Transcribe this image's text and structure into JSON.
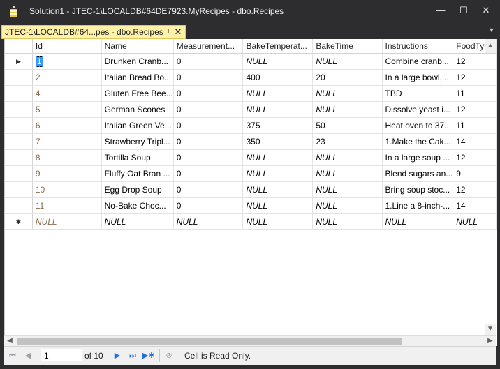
{
  "window": {
    "title": "Solution1 - JTEC-1\\LOCALDB#64DE7923.MyRecipes - dbo.Recipes",
    "minimize_glyph": "—",
    "maximize_glyph": "☐",
    "close_glyph": "✕"
  },
  "tab": {
    "label": "JTEC-1\\LOCALDB#64...pes - dbo.Recipes",
    "pin_glyph": "⊣",
    "close_glyph": "✕",
    "active_color": "#fff1a8"
  },
  "grid": {
    "columns": [
      "Id",
      "Name",
      "Measurement...",
      "BakeTemperat...",
      "BakeTime",
      "Instructions",
      "FoodTypeI"
    ],
    "rows": [
      {
        "marker": "▶",
        "cells": [
          "1",
          "Drunken Cranb...",
          "0",
          "NULL",
          "NULL",
          "Combine cranb...",
          "12"
        ]
      },
      {
        "marker": "",
        "cells": [
          "2",
          "Italian Bread Bo...",
          "0",
          "400",
          "20",
          "In a large bowl, ...",
          "12"
        ]
      },
      {
        "marker": "",
        "cells": [
          "4",
          "Gluten Free Bee...",
          "0",
          "NULL",
          "NULL",
          "TBD",
          "11"
        ]
      },
      {
        "marker": "",
        "cells": [
          "5",
          "German Scones",
          "0",
          "NULL",
          "NULL",
          "Dissolve yeast i...",
          "12"
        ]
      },
      {
        "marker": "",
        "cells": [
          "6",
          "Italian Green Ve...",
          "0",
          "375",
          "50",
          "Heat oven to 37...",
          "11"
        ]
      },
      {
        "marker": "",
        "cells": [
          "7",
          "Strawberry Tripl...",
          "0",
          "350",
          "23",
          "1.Make the Cak...",
          "14"
        ]
      },
      {
        "marker": "",
        "cells": [
          "8",
          "Tortilla Soup",
          "0",
          "NULL",
          "NULL",
          "In a large soup ...",
          "12"
        ]
      },
      {
        "marker": "",
        "cells": [
          "9",
          "Fluffy Oat Bran ...",
          "0",
          "NULL",
          "NULL",
          "Blend sugars an...",
          "9"
        ]
      },
      {
        "marker": "",
        "cells": [
          "10",
          "Egg Drop Soup",
          "0",
          "NULL",
          "NULL",
          "Bring soup stoc...",
          "12"
        ]
      },
      {
        "marker": "",
        "cells": [
          "11",
          "No-Bake Choc...",
          "0",
          "NULL",
          "NULL",
          "1.Line a 8-inch-...",
          "14"
        ]
      },
      {
        "marker": "✱",
        "cells": [
          "NULL",
          "NULL",
          "NULL",
          "NULL",
          "NULL",
          "NULL",
          "NULL"
        ]
      }
    ],
    "selection_color": "#3399ff"
  },
  "navigator": {
    "current_page": "1",
    "of_label": "of 10",
    "status": "Cell is Read Only.",
    "accent_color": "#1e6fd9"
  }
}
